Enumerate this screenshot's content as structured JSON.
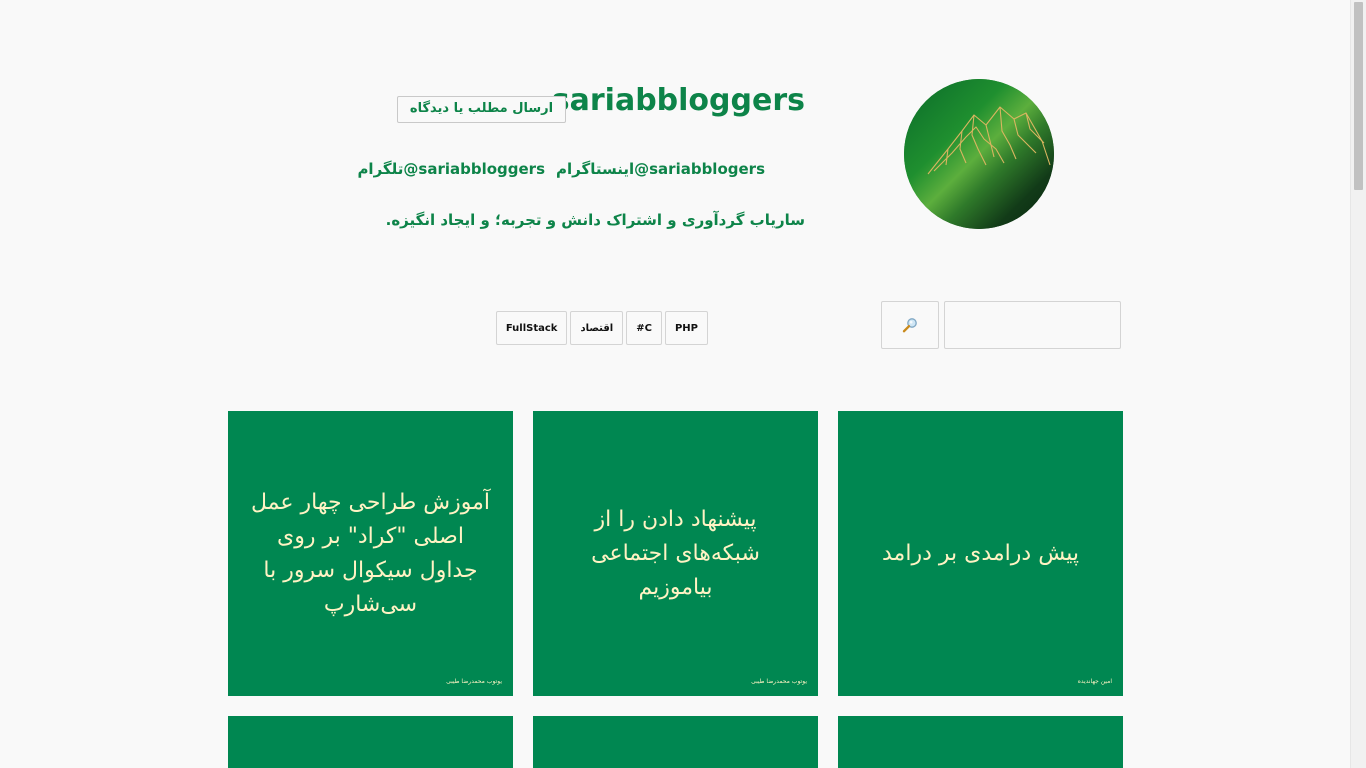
{
  "header": {
    "title": "sariabbloggers",
    "submit_label": "ارسال مطلب یا دیدگاه",
    "instagram_label": "اینستاگرام@sariabblogers",
    "telegram_label": "تلگرام@sariabbloggers",
    "tagline": "ساریاب گردآوری و اشتراک دانش و تجربه؛ و ایجاد انگیزه."
  },
  "search": {
    "value": "",
    "button_icon": "magnifier-icon"
  },
  "tags": [
    "PHP",
    "#C",
    "اقتصاد",
    "FullStack"
  ],
  "posts": [
    {
      "title": "پیش درامدی بر درامد",
      "author": "امین جهاندیده"
    },
    {
      "title": "پیشنهاد دادن را از شبکه‌های اجتماعی بیاموزیم",
      "author": "یوتوب محمدرضا طیبی"
    },
    {
      "title": "آموزش طراحی چهار عمل اصلی \"کراد\" بر روی جداول سیکوال سرور با سی‌شارپ",
      "author": "یوتوب محمدرضا طیبی"
    },
    {
      "title": "",
      "author": ""
    },
    {
      "title": "",
      "author": ""
    },
    {
      "title": "",
      "author": ""
    }
  ],
  "colors": {
    "brand": "#0d8449",
    "card_bg": "#008751",
    "card_text": "#fff3c4",
    "page_bg": "#f9f9f9"
  },
  "avatar_icon": "mountain-logo-icon"
}
